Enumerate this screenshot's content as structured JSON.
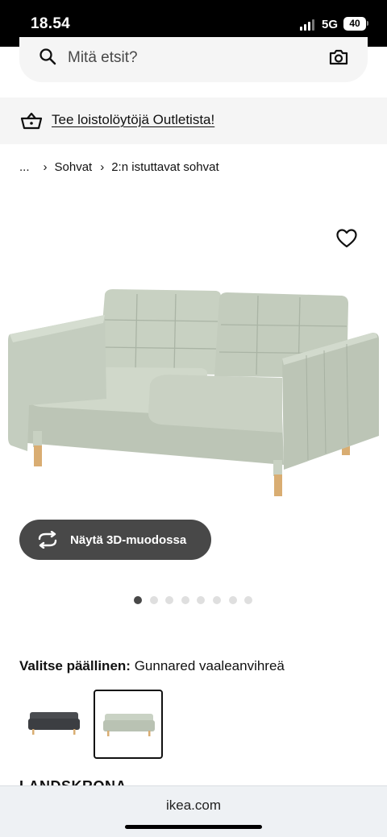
{
  "status_bar": {
    "time": "18.54",
    "network": "5G",
    "battery": "40"
  },
  "search": {
    "placeholder": "Mitä etsit?"
  },
  "promo": {
    "text": "Tee loistolöytöjä Outletista!"
  },
  "breadcrumb": {
    "ellipsis": "...",
    "items": [
      "Sohvat",
      "2:n istuttavat sohvat"
    ]
  },
  "product": {
    "view_3d_label": "Näytä 3D-muodossa",
    "image_count": 8,
    "active_image_index": 0,
    "cover_label": "Valitse päällinen:",
    "cover_value": "Gunnared vaaleanvihreä",
    "name": "LANDSKRONA"
  },
  "swatches": [
    {
      "name": "dark-grey",
      "color": "#4a4c50",
      "selected": false
    },
    {
      "name": "light-green",
      "color": "#c9d2c4",
      "selected": true
    }
  ],
  "browser": {
    "url": "ikea.com"
  },
  "colors": {
    "sofa": "#c8d1c2",
    "sofa_shadow": "#aeb8a9",
    "legs": "#d9ad72"
  }
}
